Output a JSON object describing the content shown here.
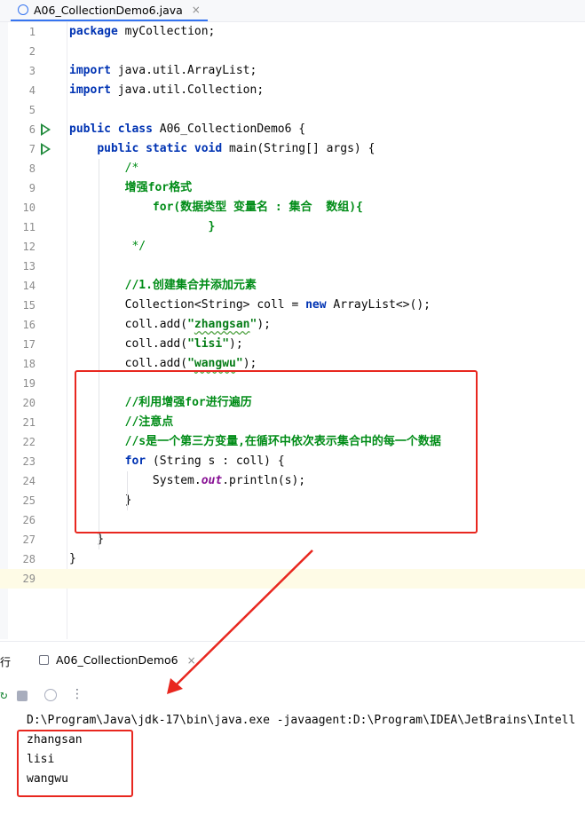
{
  "editor": {
    "tab_title": "A06_CollectionDemo6.java",
    "tab_close": "×",
    "lines": [
      {
        "n": "1",
        "segments": [
          {
            "t": "package",
            "c": "kw"
          },
          {
            "t": " myCollection;",
            "c": ""
          }
        ]
      },
      {
        "n": "2",
        "segments": []
      },
      {
        "n": "3",
        "segments": [
          {
            "t": "import",
            "c": "kw"
          },
          {
            "t": " java.util.ArrayList;",
            "c": ""
          }
        ]
      },
      {
        "n": "4",
        "segments": [
          {
            "t": "import",
            "c": "kw"
          },
          {
            "t": " java.util.Collection;",
            "c": ""
          }
        ]
      },
      {
        "n": "5",
        "segments": []
      },
      {
        "n": "6",
        "run": true,
        "segments": [
          {
            "t": "public class",
            "c": "kw"
          },
          {
            "t": " A06_CollectionDemo6 {",
            "c": ""
          }
        ]
      },
      {
        "n": "7",
        "run": true,
        "segments": [
          {
            "t": "    "
          },
          {
            "t": "public static void",
            "c": "kw"
          },
          {
            "t": " main(String[] args) {",
            "c": ""
          }
        ]
      },
      {
        "n": "8",
        "segments": [
          {
            "t": "        "
          },
          {
            "t": "/*",
            "c": "cm"
          }
        ]
      },
      {
        "n": "9",
        "segments": [
          {
            "t": "        "
          },
          {
            "t": "增强for格式",
            "c": "cmb"
          }
        ]
      },
      {
        "n": "10",
        "segments": [
          {
            "t": "            "
          },
          {
            "t": "for(数据类型 变量名 : 集合  数组){",
            "c": "cmb"
          }
        ]
      },
      {
        "n": "11",
        "segments": [
          {
            "t": "                    "
          },
          {
            "t": "}",
            "c": "cmb"
          }
        ]
      },
      {
        "n": "12",
        "segments": [
          {
            "t": "         "
          },
          {
            "t": "*/",
            "c": "cm"
          }
        ]
      },
      {
        "n": "13",
        "segments": []
      },
      {
        "n": "14",
        "segments": [
          {
            "t": "        "
          },
          {
            "t": "//1.创建集合并添加元素",
            "c": "cmb"
          }
        ]
      },
      {
        "n": "15",
        "segments": [
          {
            "t": "        Collection<String> coll = "
          },
          {
            "t": "new",
            "c": "kw"
          },
          {
            "t": " ArrayList<>();"
          }
        ]
      },
      {
        "n": "16",
        "segments": [
          {
            "t": "        coll.add("
          },
          {
            "t": "\"",
            "c": "str"
          },
          {
            "t": "zhangsan",
            "c": "str wavy"
          },
          {
            "t": "\"",
            "c": "str"
          },
          {
            "t": ");"
          }
        ]
      },
      {
        "n": "17",
        "segments": [
          {
            "t": "        coll.add("
          },
          {
            "t": "\"lisi\"",
            "c": "str"
          },
          {
            "t": ");"
          }
        ]
      },
      {
        "n": "18",
        "segments": [
          {
            "t": "        coll.add("
          },
          {
            "t": "\"",
            "c": "str"
          },
          {
            "t": "wangwu",
            "c": "str wavy"
          },
          {
            "t": "\"",
            "c": "str"
          },
          {
            "t": ");"
          }
        ]
      },
      {
        "n": "19",
        "segments": []
      },
      {
        "n": "20",
        "segments": [
          {
            "t": "        "
          },
          {
            "t": "//利用增强for进行遍历",
            "c": "cmb"
          }
        ]
      },
      {
        "n": "21",
        "segments": [
          {
            "t": "        "
          },
          {
            "t": "//注意点",
            "c": "cmb"
          }
        ]
      },
      {
        "n": "22",
        "segments": [
          {
            "t": "        "
          },
          {
            "t": "//s是一个第三方变量,在循环中依次表示集合中的每一个数据",
            "c": "cmb"
          }
        ]
      },
      {
        "n": "23",
        "segments": [
          {
            "t": "        "
          },
          {
            "t": "for",
            "c": "kw"
          },
          {
            "t": " (String s : coll) {"
          }
        ]
      },
      {
        "n": "24",
        "segments": [
          {
            "t": "            System."
          },
          {
            "t": "out",
            "c": "ital"
          },
          {
            "t": ".println(s);"
          }
        ]
      },
      {
        "n": "25",
        "segments": [
          {
            "t": "        }"
          }
        ]
      },
      {
        "n": "26",
        "segments": []
      },
      {
        "n": "27",
        "segments": [
          {
            "t": "    }"
          }
        ]
      },
      {
        "n": "28",
        "segments": [
          {
            "t": "}"
          }
        ]
      },
      {
        "n": "29",
        "current": true,
        "segments": []
      }
    ]
  },
  "run_panel": {
    "title": "运行",
    "tab_title": "A06_CollectionDemo6",
    "tab_close": "×",
    "more": "⋮",
    "rerun": "↻",
    "console": [
      "D:\\Program\\Java\\jdk-17\\bin\\java.exe -javaagent:D:\\Program\\IDEA\\JetBrains\\Intell",
      "zhangsan",
      "lisi",
      "wangwu"
    ]
  },
  "colors": {
    "annotation": "#e8271f",
    "accent": "#3574f0",
    "run": "#208a3c"
  }
}
